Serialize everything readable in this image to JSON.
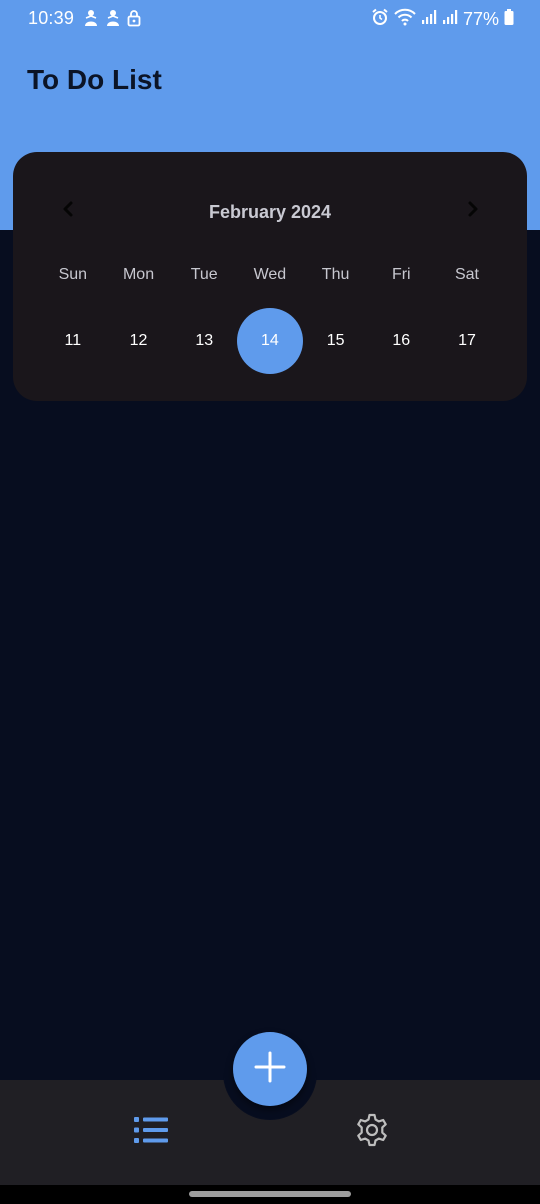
{
  "status_bar": {
    "time": "10:39",
    "battery_percent": "77%",
    "left_icons": [
      "person-icon",
      "person-icon",
      "lock-icon"
    ],
    "right_icons": [
      "alarm-icon",
      "wifi-icon",
      "signal-icon",
      "signal-icon",
      "battery-icon"
    ]
  },
  "header": {
    "title": "To Do List"
  },
  "calendar": {
    "month_label": "February 2024",
    "prev_icon": "chevron-left-icon",
    "next_icon": "chevron-right-icon",
    "weekdays": [
      "Sun",
      "Mon",
      "Tue",
      "Wed",
      "Thu",
      "Fri",
      "Sat"
    ],
    "days": [
      "11",
      "12",
      "13",
      "14",
      "15",
      "16",
      "17"
    ],
    "selected_day": "14"
  },
  "fab": {
    "icon": "plus-icon"
  },
  "bottom_nav": {
    "items": [
      {
        "icon": "list-icon",
        "active": true
      },
      {
        "icon": "gear-icon",
        "active": false
      }
    ]
  },
  "colors": {
    "accent": "#5f9bec",
    "background": "#070d1f",
    "card": "#1a161b",
    "nav_bar": "#201f24",
    "title_text": "#0b1427"
  }
}
